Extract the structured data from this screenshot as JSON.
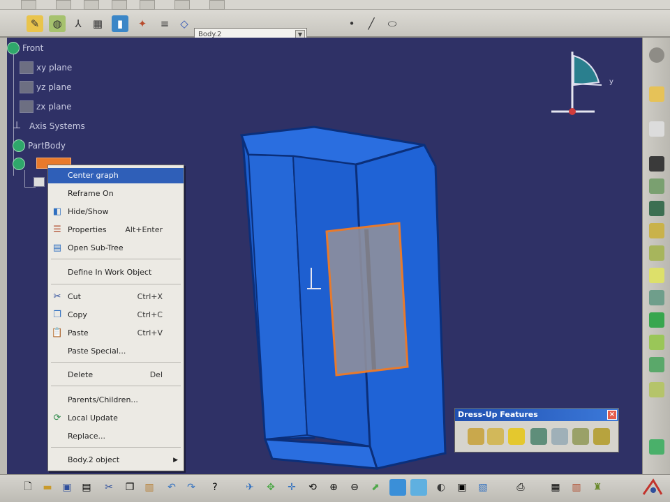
{
  "toolbar": {
    "current_body": "Body.2"
  },
  "tree": {
    "root": "Front",
    "items": [
      {
        "label": "xy plane",
        "icon": "plane-icon"
      },
      {
        "label": "yz plane",
        "icon": "plane-icon"
      },
      {
        "label": "zx plane",
        "icon": "plane-icon"
      },
      {
        "label": "Axis Systems",
        "icon": "axis-system-icon"
      },
      {
        "label": "PartBody",
        "icon": "part-body-icon"
      }
    ]
  },
  "context_menu": {
    "items": [
      {
        "label": "Center graph",
        "shortcut": "",
        "icon": "",
        "highlighted": true
      },
      {
        "label": "Reframe On",
        "shortcut": "",
        "icon": ""
      },
      {
        "label": "Hide/Show",
        "shortcut": "",
        "icon": "hide-show-icon"
      },
      {
        "label": "Properties",
        "shortcut": "Alt+Enter",
        "icon": "properties-icon"
      },
      {
        "label": "Open Sub-Tree",
        "shortcut": "",
        "icon": "open-subtree-icon"
      },
      {
        "label": "Define In Work Object",
        "shortcut": "",
        "icon": ""
      },
      {
        "label": "Cut",
        "shortcut": "Ctrl+X",
        "icon": "scissors-icon"
      },
      {
        "label": "Copy",
        "shortcut": "Ctrl+C",
        "icon": "copy-icon"
      },
      {
        "label": "Paste",
        "shortcut": "Ctrl+V",
        "icon": "paste-icon"
      },
      {
        "label": "Paste Special...",
        "shortcut": "",
        "icon": ""
      },
      {
        "label": "Delete",
        "shortcut": "Del",
        "icon": ""
      },
      {
        "label": "Parents/Children...",
        "shortcut": "",
        "icon": ""
      },
      {
        "label": "Local Update",
        "shortcut": "",
        "icon": "update-icon"
      },
      {
        "label": "Replace...",
        "shortcut": "",
        "icon": ""
      },
      {
        "label": "Body.2 object",
        "shortcut": "",
        "icon": "",
        "submenu": true
      }
    ]
  },
  "dressup_toolbar": {
    "title": "Dress-Up Features",
    "close": "×",
    "icons": [
      "fillet-icon",
      "chamfer-icon",
      "draft-icon",
      "shell-icon",
      "thickness-icon",
      "thread-icon",
      "remove-face-icon",
      "replace-face-icon"
    ]
  },
  "colors": {
    "viewport_bg": "#2f3166",
    "part_blue": "#1f63d6",
    "selection_orange": "#e87a2c",
    "menu_highlight": "#2f5fb8",
    "title_bar": "#1f4fb0"
  }
}
